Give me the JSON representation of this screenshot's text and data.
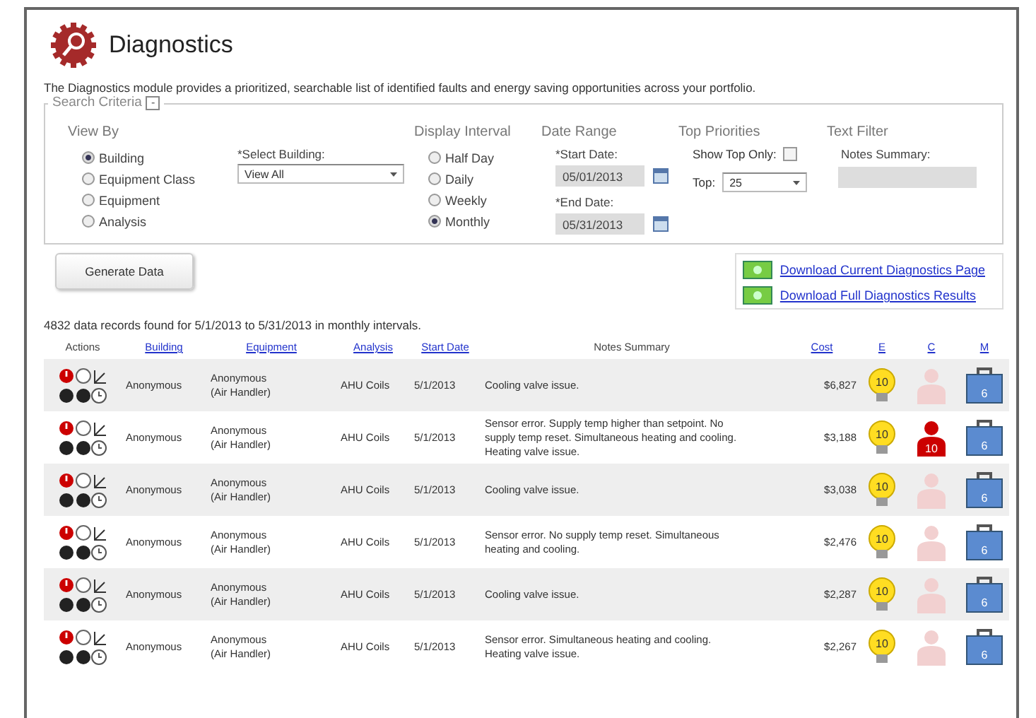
{
  "title": "Diagnostics",
  "description": "The Diagnostics module provides a prioritized, searchable list of identified faults and energy saving opportunities across your portfolio.",
  "search_criteria": {
    "legend": "Search Criteria",
    "collapse": "-",
    "view_by": {
      "heading": "View By",
      "options": [
        {
          "label": "Building",
          "selected": true
        },
        {
          "label": "Equipment Class",
          "selected": false
        },
        {
          "label": "Equipment",
          "selected": false
        },
        {
          "label": "Analysis",
          "selected": false
        }
      ]
    },
    "select_building": {
      "label": "*Select Building:",
      "value": "View All"
    },
    "display_interval": {
      "heading": "Display Interval",
      "options": [
        {
          "label": "Half Day",
          "selected": false
        },
        {
          "label": "Daily",
          "selected": false
        },
        {
          "label": "Weekly",
          "selected": false
        },
        {
          "label": "Monthly",
          "selected": true
        }
      ]
    },
    "date_range": {
      "heading": "Date Range",
      "start_label": "*Start Date:",
      "start_value": "05/01/2013",
      "end_label": "*End Date:",
      "end_value": "05/31/2013"
    },
    "top_priorities": {
      "heading": "Top Priorities",
      "show_top_label": "Show Top Only:",
      "show_top_checked": false,
      "top_label": "Top:",
      "top_value": "25"
    },
    "text_filter": {
      "heading": "Text Filter",
      "notes_label": "Notes Summary:"
    }
  },
  "generate_button": "Generate Data",
  "downloads": [
    "Download Current Diagnostics Page",
    "Download Full Diagnostics Results"
  ],
  "records_summary": "4832 data records found for 5/1/2013 to 5/31/2013 in monthly intervals.",
  "table": {
    "columns": [
      {
        "label": "Actions",
        "link": false
      },
      {
        "label": "Building",
        "link": true
      },
      {
        "label": "Equipment",
        "link": true
      },
      {
        "label": "Analysis",
        "link": true
      },
      {
        "label": "Start Date",
        "link": true
      },
      {
        "label": "Notes Summary",
        "link": false
      },
      {
        "label": "Cost",
        "link": true
      },
      {
        "label": "E",
        "link": true
      },
      {
        "label": "C",
        "link": true
      },
      {
        "label": "M",
        "link": true
      }
    ],
    "rows": [
      {
        "building": "Anonymous",
        "equipment": [
          "Anonymous",
          "(Air Handler)"
        ],
        "analysis": "AHU Coils",
        "start_date": "5/1/2013",
        "notes": "Cooling valve issue.",
        "cost": "$6,827",
        "energy": "10",
        "comfort": {
          "active": false
        },
        "maintenance": "6"
      },
      {
        "building": "Anonymous",
        "equipment": [
          "Anonymous",
          "(Air Handler)"
        ],
        "analysis": "AHU Coils",
        "start_date": "5/1/2013",
        "notes": "Sensor error. Supply temp higher than setpoint. No supply temp reset. Simultaneous heating and cooling. Heating valve issue.",
        "cost": "$3,188",
        "energy": "10",
        "comfort": {
          "active": true,
          "value": "10"
        },
        "maintenance": "6"
      },
      {
        "building": "Anonymous",
        "equipment": [
          "Anonymous",
          "(Air Handler)"
        ],
        "analysis": "AHU Coils",
        "start_date": "5/1/2013",
        "notes": "Cooling valve issue.",
        "cost": "$3,038",
        "energy": "10",
        "comfort": {
          "active": false
        },
        "maintenance": "6"
      },
      {
        "building": "Anonymous",
        "equipment": [
          "Anonymous",
          "(Air Handler)"
        ],
        "analysis": "AHU Coils",
        "start_date": "5/1/2013",
        "notes": "Sensor error. No supply temp reset. Simultaneous heating and cooling.",
        "cost": "$2,476",
        "energy": "10",
        "comfort": {
          "active": false
        },
        "maintenance": "6"
      },
      {
        "building": "Anonymous",
        "equipment": [
          "Anonymous",
          "(Air Handler)"
        ],
        "analysis": "AHU Coils",
        "start_date": "5/1/2013",
        "notes": "Cooling valve issue.",
        "cost": "$2,287",
        "energy": "10",
        "comfort": {
          "active": false
        },
        "maintenance": "6"
      },
      {
        "building": "Anonymous",
        "equipment": [
          "Anonymous",
          "(Air Handler)"
        ],
        "analysis": "AHU Coils",
        "start_date": "5/1/2013",
        "notes": "Sensor error. Simultaneous heating and cooling. Heating valve issue.",
        "cost": "$2,267",
        "energy": "10",
        "comfort": {
          "active": false
        },
        "maintenance": "6"
      }
    ]
  }
}
